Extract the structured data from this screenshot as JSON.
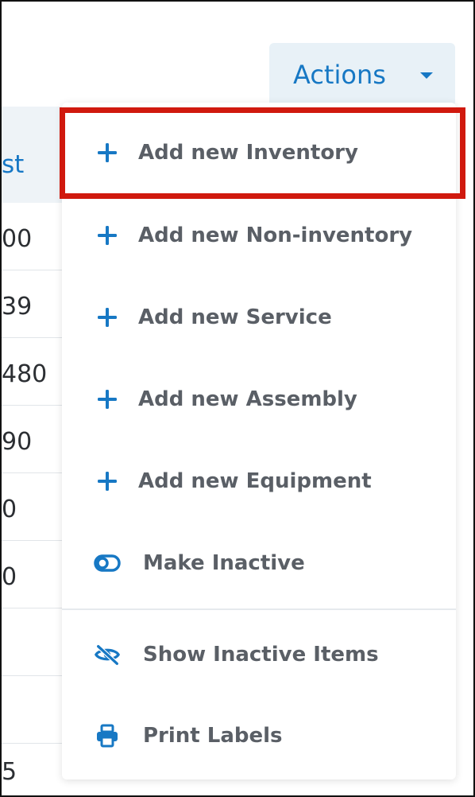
{
  "background_table": {
    "header": "st",
    "rows": [
      "00",
      "39",
      "480",
      "90",
      "0",
      "0",
      "",
      "",
      "5"
    ]
  },
  "actions": {
    "label": "Actions",
    "caret_icon": "caret-down-icon"
  },
  "menu": {
    "items": [
      {
        "label": "Add new Inventory",
        "icon": "plus-icon"
      },
      {
        "label": "Add new Non-inventory",
        "icon": "plus-icon"
      },
      {
        "label": "Add new Service",
        "icon": "plus-icon"
      },
      {
        "label": "Add new Assembly",
        "icon": "plus-icon"
      },
      {
        "label": "Add new Equipment",
        "icon": "plus-icon"
      },
      {
        "label": "Make Inactive",
        "icon": "toggle-icon"
      },
      {
        "label": "Show Inactive Items",
        "icon": "eye-slash-icon"
      },
      {
        "label": "Print Labels",
        "icon": "printer-icon"
      }
    ]
  },
  "colors": {
    "accent": "#1778c4",
    "highlight": "#d0190e",
    "menu_text": "#5a5f66"
  }
}
